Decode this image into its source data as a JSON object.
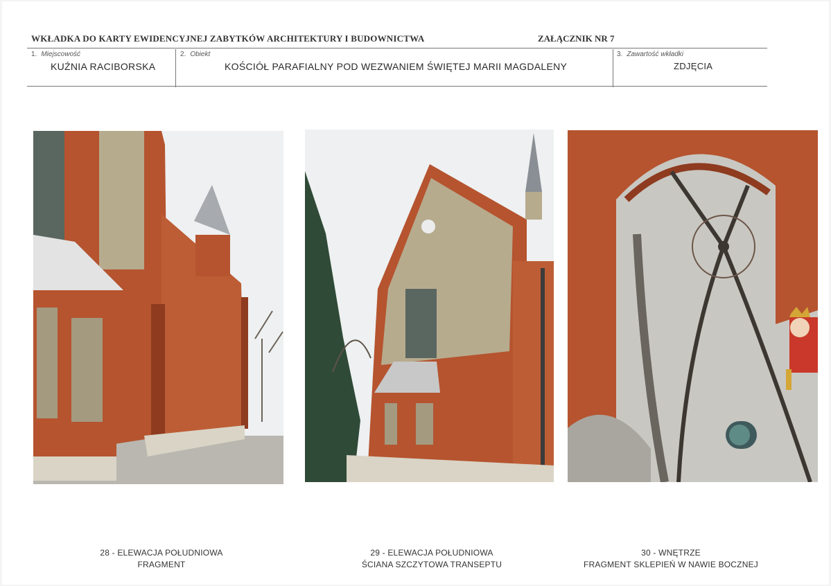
{
  "header": {
    "title": "WKŁADKA DO KARTY EWIDENCYJNEJ ZABYTKÓW ARCHITEKTURY I BUDOWNICTWA",
    "annex": "ZAŁĄCZNIK NR  7"
  },
  "fields": [
    {
      "number": "1.",
      "label": "Miejscowość",
      "value": "KUŹNIA RACIBORSKA"
    },
    {
      "number": "2.",
      "label": "Obiekt",
      "value": "KOŚCIÓŁ PARAFIALNY POD WEZWANIEM ŚWIĘTEJ MARII MAGDALENY"
    },
    {
      "number": "3.",
      "label": "Zawartość wkładki",
      "value": "ZDJĘCIA"
    }
  ],
  "captions": [
    {
      "line1": "28 -  ELEWACJA POŁUDNIOWA",
      "line2": "FRAGMENT"
    },
    {
      "line1": "29 -  ELEWACJA POŁUDNIOWA",
      "line2": "ŚCIANA SZCZYTOWA  TRANSEPTU"
    },
    {
      "line1": "30  - WNĘTRZE",
      "line2": "FRAGMENT  SKLEPIEŃ  W  NAWIE  BOCZNEJ"
    }
  ],
  "colors": {
    "brick": "#b5542f",
    "brick_dark": "#8e3b1f",
    "plaster": "#b7ab8e",
    "sky": "#eef0f1",
    "vault": "#c9c7c2",
    "stone": "#d9d4c6",
    "foliage": "#2f4a36"
  }
}
